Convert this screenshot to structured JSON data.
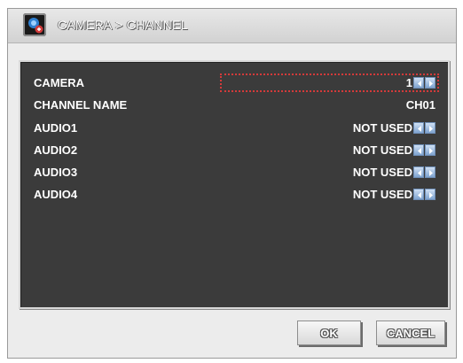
{
  "window": {
    "title": "CAMERA > CHANNEL",
    "icon": "camera-channel-icon"
  },
  "settings": [
    {
      "label": "CAMERA",
      "value": "1",
      "has_arrows": true,
      "selected": true
    },
    {
      "label": "CHANNEL NAME",
      "value": "CH01",
      "has_arrows": false,
      "selected": false
    },
    {
      "label": "AUDIO1",
      "value": "NOT USED",
      "has_arrows": true,
      "selected": false
    },
    {
      "label": "AUDIO2",
      "value": "NOT USED",
      "has_arrows": true,
      "selected": false
    },
    {
      "label": "AUDIO3",
      "value": "NOT USED",
      "has_arrows": true,
      "selected": false
    },
    {
      "label": "AUDIO4",
      "value": "NOT USED",
      "has_arrows": true,
      "selected": false
    }
  ],
  "buttons": {
    "ok": "OK",
    "cancel": "CANCEL"
  },
  "colors": {
    "panel_bg": "#3b3b3b",
    "selection": "#d43a3a",
    "arrow": "#7ea3cf"
  }
}
